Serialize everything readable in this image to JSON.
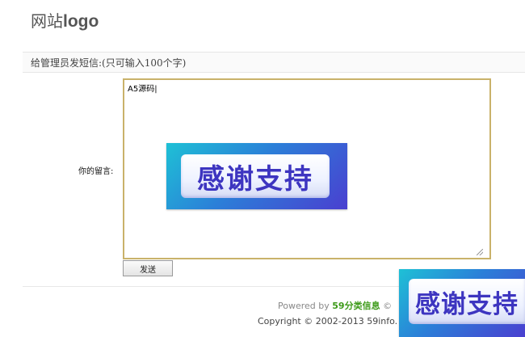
{
  "header": {
    "logo_cn": "网站",
    "logo_en": "logo"
  },
  "notice": {
    "text": "给管理员发短信:(只可输入100个字)"
  },
  "form": {
    "message_label": "你的留言:",
    "message_value": "A5源码|",
    "send_label": "发送"
  },
  "badges": {
    "thanks_text": "感谢支持"
  },
  "footer": {
    "powered_prefix": "Powered by ",
    "powered_brand": "59分类信息",
    "powered_suffix": " ©",
    "copyright": "Copyright © 2002-2013 59info."
  },
  "colors": {
    "textarea_border": "#c9b26a",
    "brand_green": "#3c9a18",
    "badge_text": "#3d35c0"
  }
}
